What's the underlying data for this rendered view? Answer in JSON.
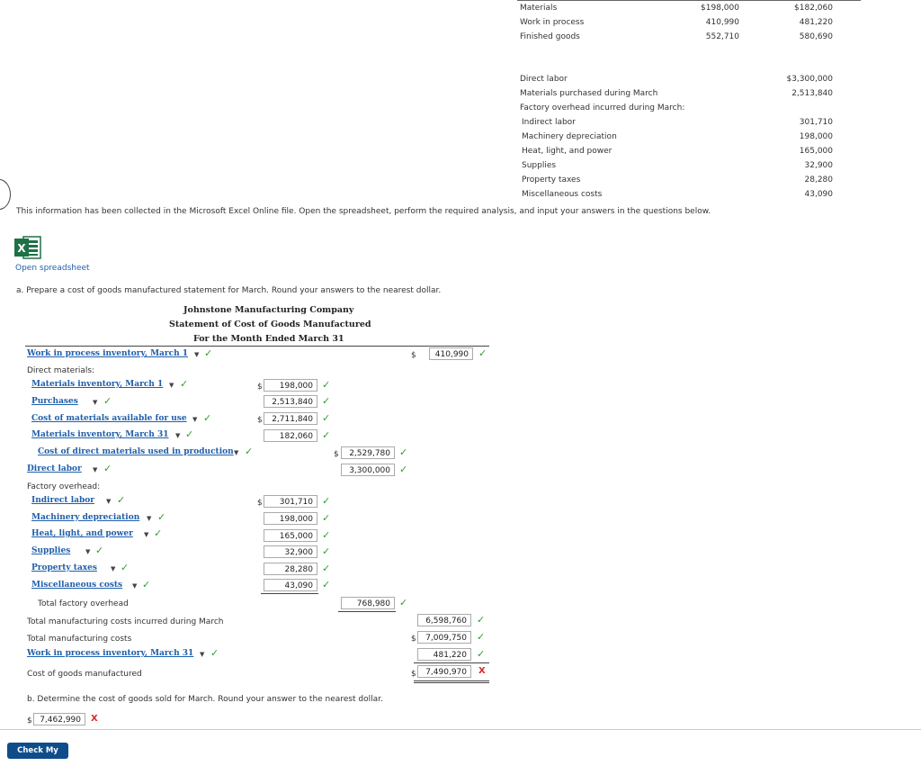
{
  "top_table": {
    "rows": [
      {
        "label": "Materials",
        "v1": "$198,000",
        "v2": "$182,060"
      },
      {
        "label": "Work in process",
        "v1": "410,990",
        "v2": "481,220"
      },
      {
        "label": "Finished goods",
        "v1": "552,710",
        "v2": "580,690"
      }
    ]
  },
  "costs": {
    "rows": [
      {
        "label": "Direct labor",
        "value": "$3,300,000"
      },
      {
        "label": "Materials purchased during March",
        "value": "2,513,840"
      },
      {
        "label": "Factory overhead incurred during March:",
        "value": ""
      },
      {
        "label": "Indirect labor",
        "value": "301,710"
      },
      {
        "label": "Machinery depreciation",
        "value": "198,000"
      },
      {
        "label": "Heat, light, and power",
        "value": "165,000"
      },
      {
        "label": "Supplies",
        "value": "32,900"
      },
      {
        "label": "Property taxes",
        "value": "28,280"
      },
      {
        "label": "Miscellaneous costs",
        "value": "43,090"
      }
    ]
  },
  "info_text": "This information has been collected in the Microsoft Excel Online file. Open the spreadsheet, perform the required analysis, and input your answers in the questions below.",
  "open_spreadsheet": "Open spreadsheet",
  "part_a": "a. Prepare a cost of goods manufactured statement for March. Round your answers to the nearest dollar.",
  "statement": {
    "company": "Johnstone Manufacturing Company",
    "title": "Statement of Cost of Goods Manufactured",
    "period": "For the Month Ended March 31",
    "wip_begin_label": "Work in process inventory, March 1",
    "wip_begin_value": "410,990",
    "direct_materials": "Direct materials:",
    "mat_inv_label": "Materials inventory, March 1",
    "mat_inv_value": "198,000",
    "purchases_label": "Purchases",
    "purchases_value": "2,513,840",
    "cost_avail_label": "Cost of materials available for use",
    "cost_avail_value": "2,711,840",
    "mat_end_label": "Materials inventory, March 31",
    "mat_end_value": "182,060",
    "dm_used_label": "Cost of direct materials used in production",
    "dm_used_value": "2,529,780",
    "dl_label": "Direct labor",
    "dl_value": "3,300,000",
    "fo_label": "Factory overhead:",
    "oh_items": [
      {
        "label": "Indirect labor",
        "value": "301,710"
      },
      {
        "label": "Machinery depreciation",
        "value": "198,000"
      },
      {
        "label": "Heat, light, and power",
        "value": "165,000"
      },
      {
        "label": "Supplies",
        "value": "32,900"
      },
      {
        "label": "Property taxes",
        "value": "28,280"
      },
      {
        "label": "Miscellaneous costs",
        "value": "43,090"
      }
    ],
    "total_oh_label": "Total factory overhead",
    "total_oh_value": "768,980",
    "tmc_incurred_label": "Total manufacturing costs incurred during March",
    "tmc_incurred_value": "6,598,760",
    "tmc_label": "Total manufacturing costs",
    "tmc_value": "7,009,750",
    "wip_end_label": "Work in process inventory, March 31",
    "wip_end_value": "481,220",
    "cogm_label": "Cost of goods manufactured",
    "cogm_value": "7,490,970"
  },
  "part_b": "b. Determine the cost of goods sold for March. Round your answer to the nearest dollar.",
  "part_b_value": "7,462,990",
  "dollar_sign": "$",
  "check_mark": "✓",
  "x_mark": "X",
  "check_btn": "Check My Work",
  "colors": {
    "link": "#1f5faa",
    "correct": "#2e9e2e",
    "incorrect": "#d62c2c",
    "button": "#0f4d8a"
  }
}
